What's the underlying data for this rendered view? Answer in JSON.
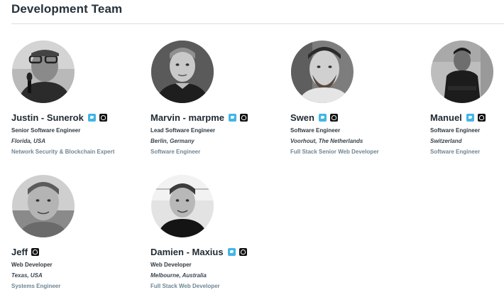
{
  "section": {
    "title": "Development Team"
  },
  "members": [
    {
      "name": "Justin - Sunerok",
      "role": "Senior Software Engineer",
      "location": "Florida, USA",
      "specialty": "Network Security & Blockchain Expert",
      "icons": [
        "twitter-icon",
        "github-icon"
      ]
    },
    {
      "name": "Marvin - marpme",
      "role": "Lead Software Engineer",
      "location": "Berlin, Germany",
      "specialty": "Software Engineer",
      "icons": [
        "twitter-icon",
        "github-icon"
      ]
    },
    {
      "name": "Swen",
      "role": "Software Engineer",
      "location": "Voorhout, The Netherlands",
      "specialty": "Full Stack Senior Web Developer",
      "icons": [
        "twitter-icon",
        "github-icon"
      ]
    },
    {
      "name": "Manuel",
      "role": "Software Engineer",
      "location": "Switzerland",
      "specialty": "Software Engineer",
      "icons": [
        "twitter-icon",
        "github-icon"
      ]
    },
    {
      "name": "Jeff",
      "role": "Web Developer",
      "location": "Texas, USA",
      "specialty": "Systems Engineer",
      "icons": [
        "github-icon"
      ]
    },
    {
      "name": "Damien - Maxius",
      "role": "Web Developer",
      "location": "Melbourne, Australia",
      "specialty": "Full Stack Web Developer",
      "icons": [
        "twitter-icon",
        "github-icon"
      ]
    }
  ],
  "colors": {
    "twitter": "#41b6e6",
    "github": "#111111",
    "specialty_text": "#6f8694",
    "divider": "#d9dde1"
  }
}
